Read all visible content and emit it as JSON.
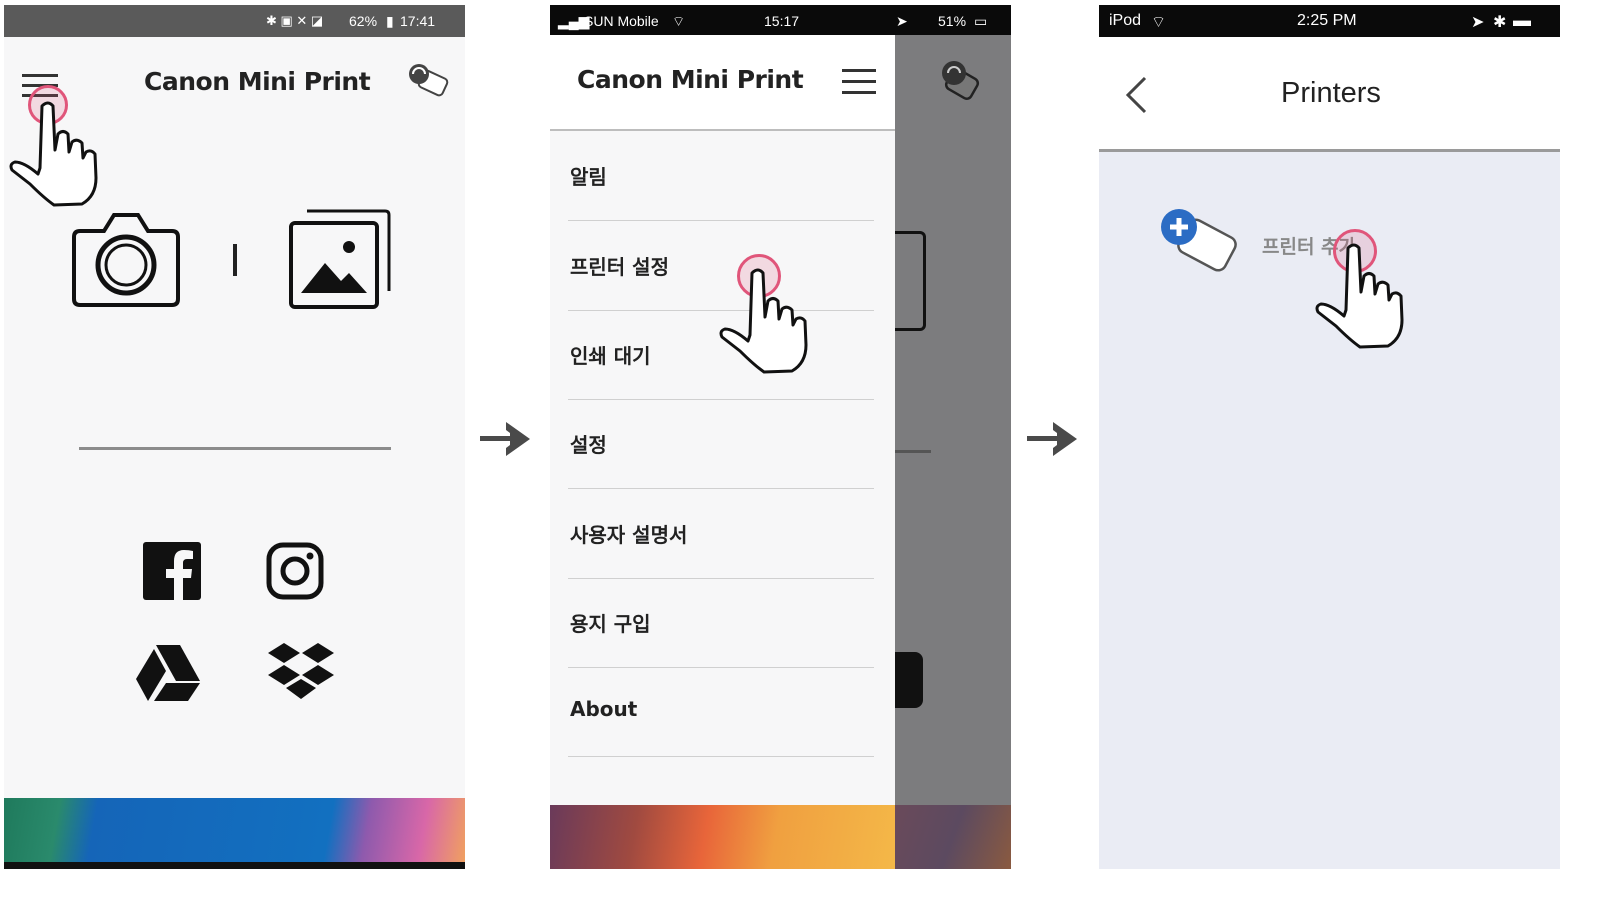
{
  "screen1": {
    "status": {
      "battery": "62%",
      "time": "17:41"
    },
    "title": "Canon Mini Print",
    "icons": [
      "menu-icon",
      "printer-link-icon",
      "camera-icon",
      "gallery-icon",
      "facebook-icon",
      "instagram-icon",
      "google-drive-icon",
      "dropbox-icon"
    ],
    "banner_colors": [
      "#2a8a6c",
      "#1565b8",
      "#9b58b0",
      "#f0a060"
    ]
  },
  "screen2": {
    "status": {
      "carrier": "SUN Mobile",
      "time": "15:17",
      "battery": "51%"
    },
    "title": "Canon Mini Print",
    "menu": [
      {
        "label": "알림"
      },
      {
        "label": "프린터 설정"
      },
      {
        "label": "인쇄 대기"
      },
      {
        "label": "설정"
      },
      {
        "label": "사용자 설명서"
      },
      {
        "label": "용지 구입"
      },
      {
        "label": "About"
      }
    ]
  },
  "screen3": {
    "status": {
      "device": "iPod",
      "time": "2:25 PM"
    },
    "title": "Printers",
    "add_printer_label": "프린터 추가"
  },
  "colors": {
    "tap_ring": "#e0557a",
    "arrow": "#4a4a4a",
    "add_badge": "#2b6cc4"
  }
}
